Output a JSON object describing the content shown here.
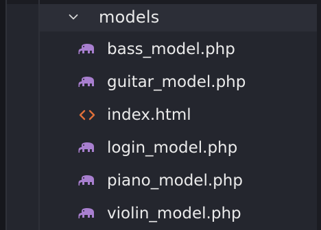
{
  "explorer": {
    "folder": {
      "name": "models",
      "state": "expanded",
      "chevron_icon": "chevron-down-icon"
    },
    "files": [
      {
        "name": "bass_model.php",
        "icon": "php-elephant-icon",
        "icon_color": "#a87fcf"
      },
      {
        "name": "guitar_model.php",
        "icon": "php-elephant-icon",
        "icon_color": "#a87fcf"
      },
      {
        "name": "index.html",
        "icon": "html-code-icon",
        "icon_color": "#e0703a"
      },
      {
        "name": "login_model.php",
        "icon": "php-elephant-icon",
        "icon_color": "#a87fcf"
      },
      {
        "name": "piano_model.php",
        "icon": "php-elephant-icon",
        "icon_color": "#a87fcf"
      },
      {
        "name": "violin_model.php",
        "icon": "php-elephant-icon",
        "icon_color": "#a87fcf"
      }
    ]
  },
  "colors": {
    "panel_bg": "#24262e",
    "folder_row_bg": "#2c2e37",
    "text": "#ebebeb",
    "php_icon": "#a87fcf",
    "html_icon": "#e0703a"
  }
}
